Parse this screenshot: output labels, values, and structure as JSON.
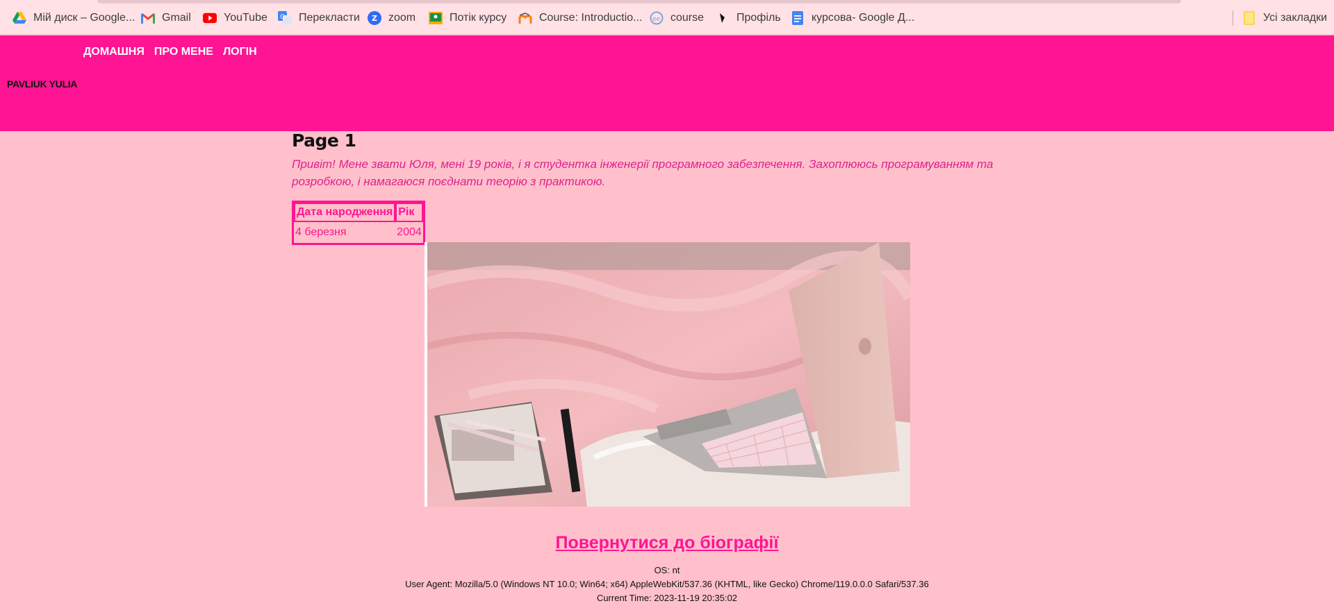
{
  "bookmarks": [
    {
      "label": "Мій диск – Google...",
      "icon": "google-drive-icon"
    },
    {
      "label": "Gmail",
      "icon": "gmail-icon"
    },
    {
      "label": "YouTube",
      "icon": "youtube-icon"
    },
    {
      "label": "Перекласти",
      "icon": "translate-icon"
    },
    {
      "label": "zoom",
      "icon": "zoom-icon"
    },
    {
      "label": "Потік курсу",
      "icon": "classroom-icon"
    },
    {
      "label": "Course: Introductio...",
      "icon": "moodle-icon"
    },
    {
      "label": "course",
      "icon": "course-icon"
    },
    {
      "label": "Профіль",
      "icon": "profile-icon"
    },
    {
      "label": "курсова- Google Д...",
      "icon": "google-docs-icon"
    }
  ],
  "all_bookmarks": {
    "label": "Усі закладки",
    "icon": "folder-icon"
  },
  "nav": {
    "home": "ДОМАШНЯ",
    "about": "ПРО МЕНЕ",
    "login": "ЛОГІН"
  },
  "brand": "PAVLIUK YULIA",
  "page": {
    "title": "Page 1",
    "intro": "Привіт! Мене звати Юля, мені 19 років, і я студентка інженерії програмного забезпечення. Захоплююсь програмуванням та розробкою, і намагаюся поєднати теорію з практикою."
  },
  "table": {
    "headers": [
      "Дата народження",
      "Рік"
    ],
    "row": [
      "4 березня",
      "2004"
    ]
  },
  "back_link": "Повернутися до біографії",
  "sysinfo": {
    "os": "OS: nt",
    "user_agent": "User Agent: Mozilla/5.0 (Windows NT 10.0; Win64; x64) AppleWebKit/537.36 (KHTML, like Gecko) Chrome/119.0.0.0 Safari/537.36",
    "time": "Current Time: 2023-11-19 20:35:02"
  },
  "colors": {
    "accent": "#ff1493",
    "background": "#ffc0cb",
    "bookmarks_bar": "#ffe1e6"
  }
}
